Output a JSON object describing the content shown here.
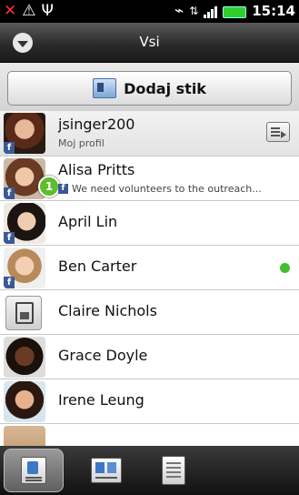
{
  "status_bar": {
    "left_icons": [
      "missed-call-icon",
      "warning-icon",
      "usb-icon"
    ],
    "time": "15:14",
    "battery_color": "#2ecf2e"
  },
  "header": {
    "title": "Vsi"
  },
  "add_contact": {
    "label": "Dodaj stik"
  },
  "profile": {
    "name": "jsinger200",
    "subtitle": "Moj profil"
  },
  "contacts": [
    {
      "name": "Alisa Pritts",
      "status": "We need volunteers to the outreach...",
      "badge": "1",
      "source": "facebook"
    },
    {
      "name": "April Lin",
      "source": "facebook"
    },
    {
      "name": "Ben Carter",
      "source": "facebook",
      "online": true
    },
    {
      "name": "Claire Nichols",
      "source": "sim"
    },
    {
      "name": "Grace Doyle"
    },
    {
      "name": "Irene Leung"
    }
  ],
  "tabs": [
    {
      "name": "people",
      "active": true
    },
    {
      "name": "groups",
      "active": false
    },
    {
      "name": "call-history",
      "active": false
    }
  ],
  "colors": {
    "online": "#40c030",
    "badge": "#5ebd2a",
    "facebook": "#3b5998"
  }
}
